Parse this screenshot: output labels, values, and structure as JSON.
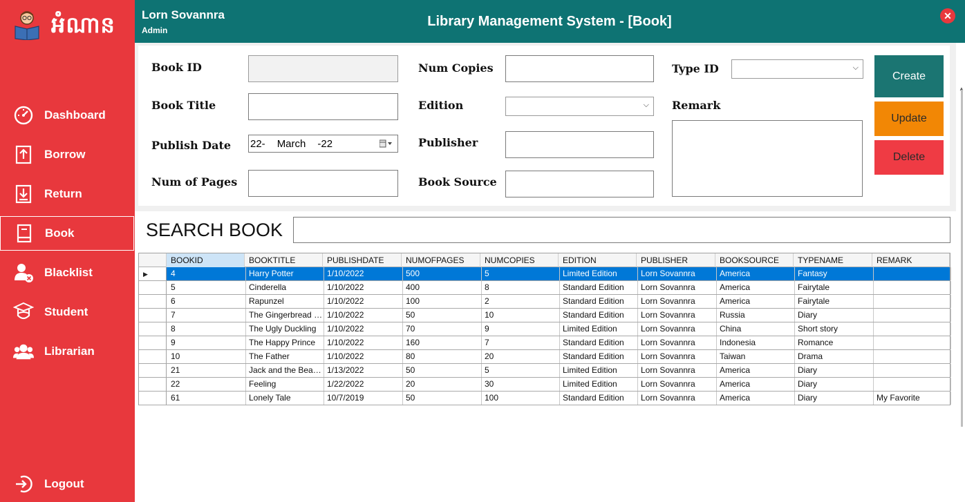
{
  "sidebar": {
    "logo_text": "អំណាន",
    "items": [
      {
        "label": "Dashboard",
        "icon": "dashboard-icon"
      },
      {
        "label": "Borrow",
        "icon": "borrow-icon"
      },
      {
        "label": "Return",
        "icon": "return-icon"
      },
      {
        "label": "Book",
        "icon": "book-icon",
        "active": true
      },
      {
        "label": "Blacklist",
        "icon": "blacklist-icon"
      },
      {
        "label": "Student",
        "icon": "student-icon"
      },
      {
        "label": "Librarian",
        "icon": "librarian-icon"
      }
    ],
    "logout": "Logout"
  },
  "header": {
    "user_name": "Lorn Sovannra",
    "user_role": "Admin",
    "title": "Library Management System - [Book]"
  },
  "form": {
    "book_id_label": "Book ID",
    "book_title_label": "Book Title",
    "publish_date_label": "Publish Date",
    "publish_date_value": {
      "day": "22-",
      "month": "March",
      "year": "-22"
    },
    "num_pages_label": "Num of Pages",
    "num_copies_label": "Num Copies",
    "edition_label": "Edition",
    "publisher_label": "Publisher",
    "book_source_label": "Book Source",
    "type_id_label": "Type ID",
    "remark_label": "Remark",
    "create_label": "Create",
    "update_label": "Update",
    "delete_label": "Delete"
  },
  "search": {
    "label": "SEARCH BOOK",
    "value": ""
  },
  "grid": {
    "columns": [
      "BOOKID",
      "BOOKTITLE",
      "PUBLISHDATE",
      "NUMOFPAGES",
      "NUMCOPIES",
      "EDITION",
      "PUBLISHER",
      "BOOKSOURCE",
      "TYPENAME",
      "REMARK"
    ],
    "rows": [
      [
        "4",
        "Harry Potter",
        "1/10/2022",
        "500",
        "5",
        "Limited Edition",
        "Lorn Sovannra",
        "America",
        "Fantasy",
        ""
      ],
      [
        "5",
        "Cinderella",
        "1/10/2022",
        "400",
        "8",
        "Standard Edition",
        "Lorn Sovannra",
        "America",
        "Fairytale",
        ""
      ],
      [
        "6",
        "Rapunzel",
        "1/10/2022",
        "100",
        "2",
        "Standard Edition",
        "Lorn Sovannra",
        "America",
        "Fairytale",
        ""
      ],
      [
        "7",
        "The Gingerbread Man",
        "1/10/2022",
        "50",
        "10",
        "Standard Edition",
        "Lorn Sovannra",
        "Russia",
        "Diary",
        ""
      ],
      [
        "8",
        "The Ugly Duckling",
        "1/10/2022",
        "70",
        "9",
        "Limited Edition",
        "Lorn Sovannra",
        "China",
        "Short story",
        ""
      ],
      [
        "9",
        "The Happy Prince",
        "1/10/2022",
        "160",
        "7",
        "Standard Edition",
        "Lorn Sovannra",
        "Indonesia",
        "Romance",
        ""
      ],
      [
        "10",
        "The Father",
        "1/10/2022",
        "80",
        "20",
        "Standard Edition",
        "Lorn Sovannra",
        "Taiwan",
        "Drama",
        ""
      ],
      [
        "21",
        "Jack and the Beans...",
        "1/13/2022",
        "50",
        "5",
        "Limited Edition",
        "Lorn Sovannra",
        "America",
        "Diary",
        ""
      ],
      [
        "22",
        "Feeling",
        "1/22/2022",
        "20",
        "30",
        "Limited Edition",
        "Lorn Sovannra",
        "America",
        "Diary",
        ""
      ],
      [
        "61",
        "Lonely Tale",
        "10/7/2019",
        "50",
        "100",
        "Standard Edition",
        "Lorn Sovannra",
        "America",
        "Diary",
        "My Favorite"
      ]
    ],
    "selected_row": 0
  },
  "colors": {
    "sidebar": "#e8383d",
    "header": "#0e7373",
    "create": "#1b7572",
    "update": "#f28705",
    "delete": "#ef3b44",
    "selection": "#0078d7"
  }
}
